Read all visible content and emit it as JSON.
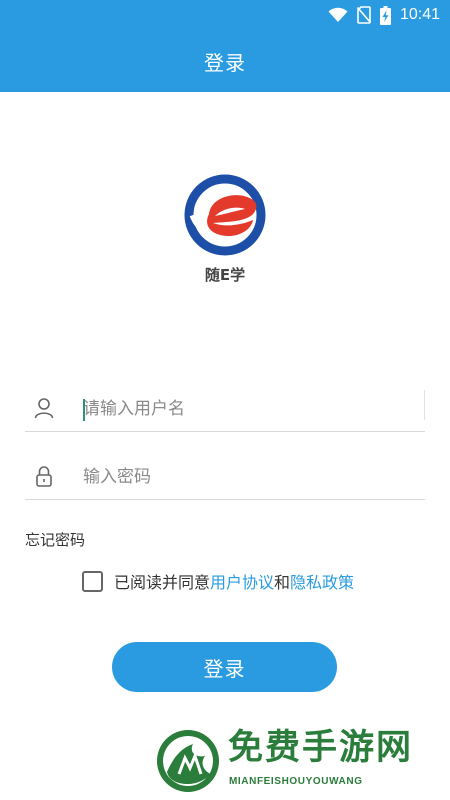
{
  "status_bar": {
    "time": "10:41",
    "icons": [
      "wifi-icon",
      "no-sim-icon",
      "battery-charging-icon"
    ]
  },
  "header": {
    "title": "登录"
  },
  "app": {
    "name": "随E学"
  },
  "form": {
    "username": {
      "placeholder": "请输入用户名",
      "value": "",
      "icon": "user-icon"
    },
    "password": {
      "placeholder": "输入密码",
      "value": "",
      "icon": "lock-icon"
    },
    "forgot_label": "忘记密码",
    "agreement": {
      "prefix": "已阅读并同意",
      "user_agreement": "用户协议",
      "connector": "和",
      "privacy_policy": "隐私政策",
      "checked": false
    },
    "submit_label": "登录"
  },
  "watermark": {
    "title": "免费手游网",
    "subtitle": "MIANFEISHOUYOUWANG"
  },
  "colors": {
    "primary": "#2a9be0",
    "watermark": "#2a7d3a",
    "logo_blue": "#1e4fa8",
    "logo_red": "#e33a2c"
  }
}
